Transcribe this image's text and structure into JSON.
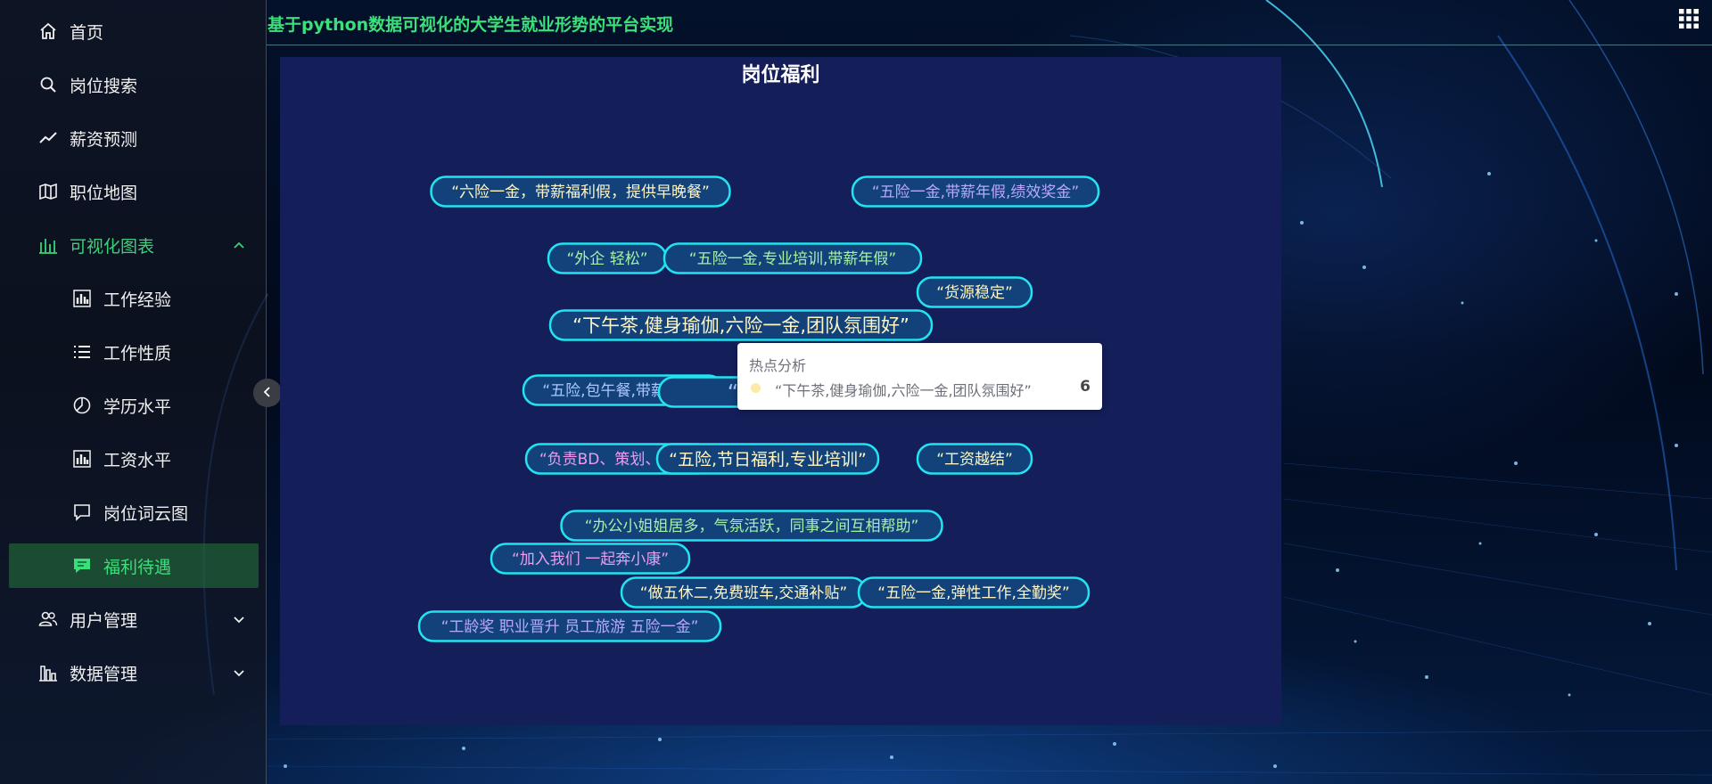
{
  "header": {
    "app_title": "基于python数据可视化的大学生就业形势的平台实现"
  },
  "sidebar": {
    "items": [
      {
        "label": "首页",
        "icon": "home-icon"
      },
      {
        "label": "岗位搜索",
        "icon": "search-icon"
      },
      {
        "label": "薪资预测",
        "icon": "trend-icon"
      },
      {
        "label": "职位地图",
        "icon": "map-icon"
      },
      {
        "label": "可视化图表",
        "icon": "bar-chart-icon",
        "expanded": true
      },
      {
        "label": "工作经验",
        "icon": "bar-chart-icon"
      },
      {
        "label": "工作性质",
        "icon": "list-icon"
      },
      {
        "label": "学历水平",
        "icon": "pie-chart-icon"
      },
      {
        "label": "工资水平",
        "icon": "bar-chart-icon"
      },
      {
        "label": "岗位词云图",
        "icon": "comment-icon"
      },
      {
        "label": "福利待遇",
        "icon": "chat-icon",
        "active": true
      },
      {
        "label": "用户管理",
        "icon": "users-icon"
      },
      {
        "label": "数据管理",
        "icon": "data-icon"
      }
    ]
  },
  "colors": {
    "accent_green": "#39d27a",
    "panel_bg": "#141f5a",
    "tag_border": "#22e3f0",
    "tag_fill": "#13427a"
  },
  "chart_data": {
    "type": "wordcloud",
    "title": "岗位福利",
    "words": [
      {
        "text": "“六险一金，带薪福利假，提供早晚餐”",
        "color": "#fff6c4"
      },
      {
        "text": "“五险一金,带薪年假,绩效奖金”",
        "color": "#b9a8ff"
      },
      {
        "text": "“外企 轻松”",
        "color": "#a6f1a9"
      },
      {
        "text": "“五险一金,专业培训,带薪年假”",
        "color": "#a6f1a9"
      },
      {
        "text": "“货源稳定”",
        "color": "#fff6c4"
      },
      {
        "text": "“下午茶,健身瑜伽,六险一金,团队氛围好”",
        "color": "#fff6c4"
      },
      {
        "text": "“五险,包午餐,带薪年假”",
        "color": "#a9c8ff"
      },
      {
        "text": "“大",
        "color": "#a9c8ff"
      },
      {
        "text": "“负责BD、策划、执行”",
        "color": "#ee9cf0"
      },
      {
        "text": "“五险,节日福利,专业培训”",
        "color": "#fff6c4"
      },
      {
        "text": "“工资越结”",
        "color": "#fff6c4"
      },
      {
        "text": "“办公小姐姐居多，气氛活跃，同事之间互相帮助”",
        "color": "#a6f1a9"
      },
      {
        "text": "“加入我们 一起奔小康”",
        "color": "#ee9cf0"
      },
      {
        "text": "“做五休二,免费班车,交通补贴”",
        "color": "#fff6c4"
      },
      {
        "text": "“五险一金,弹性工作,全勤奖”",
        "color": "#fff6c4"
      },
      {
        "text": "“工龄奖 职业晋升 员工旅游 五险一金”",
        "color": "#b9a8ff"
      }
    ],
    "tooltip": {
      "title": "热点分析",
      "name": "“下午茶,健身瑜伽,六险一金,团队氛围好”",
      "value": 6
    }
  }
}
